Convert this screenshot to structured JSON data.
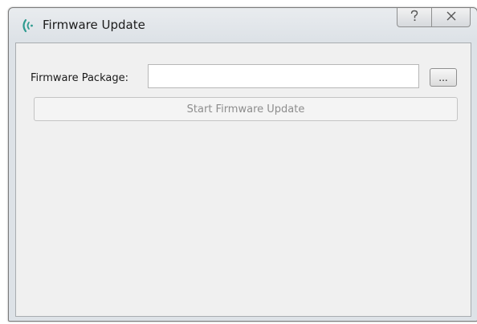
{
  "window": {
    "title": "Firmware Update",
    "help_button_icon": "question-mark-icon",
    "close_button_icon": "close-x-icon",
    "app_icon": "wireless-signal-icon"
  },
  "form": {
    "package_label": "Firmware Package:",
    "package_value": "",
    "browse_label": "...",
    "start_label": "Start Firmware Update",
    "start_enabled": false
  },
  "colors": {
    "app_icon": "#2e9b8f",
    "disabled_text": "#8d8d8d"
  }
}
